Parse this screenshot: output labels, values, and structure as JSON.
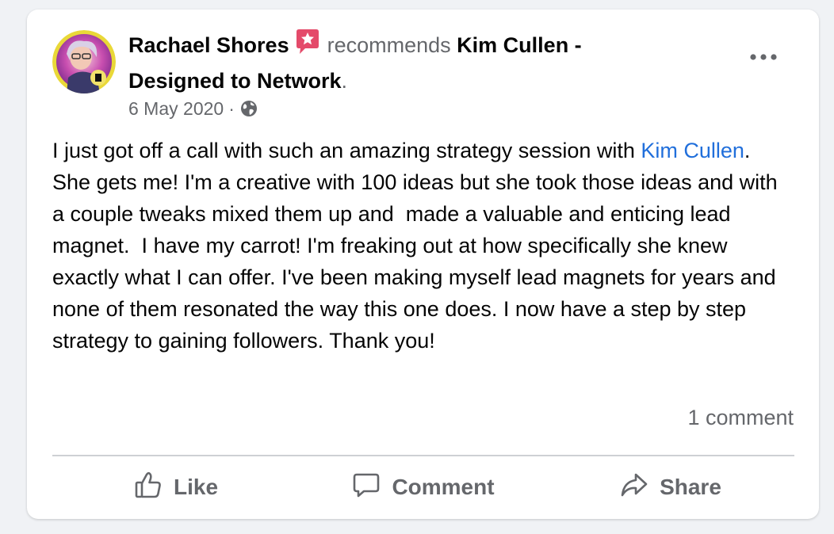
{
  "post": {
    "author": "Rachael Shores",
    "verb": "recommends",
    "page_name": "Kim Cullen - Designed to Network",
    "page_suffix": ".",
    "date": "6 May 2020",
    "separator": "·",
    "audience_icon": "globe-icon",
    "badge_icon": "recommendation-star-icon",
    "more_icon": "more-options-icon",
    "body_part1": "I just got off a call with such an amazing strategy session with ",
    "mention": "Kim Cullen",
    "body_part2": ".  She gets me! I'm a creative with 100 ideas but she took those ideas and with a couple tweaks mixed them up and  made a valuable and enticing lead magnet.  I have my carrot! I'm freaking out at how specifically she knew exactly what I can offer. I've been making myself lead magnets for years and none of them resonated the way this one does. I now have a step by step strategy to gaining followers. Thank you!",
    "comment_count": "1 comment"
  },
  "actions": {
    "like": "Like",
    "comment": "Comment",
    "share": "Share"
  },
  "colors": {
    "link": "#216fdb",
    "secondary_text": "#65676b",
    "badge": "#e44a6a",
    "background": "#f0f2f5"
  }
}
